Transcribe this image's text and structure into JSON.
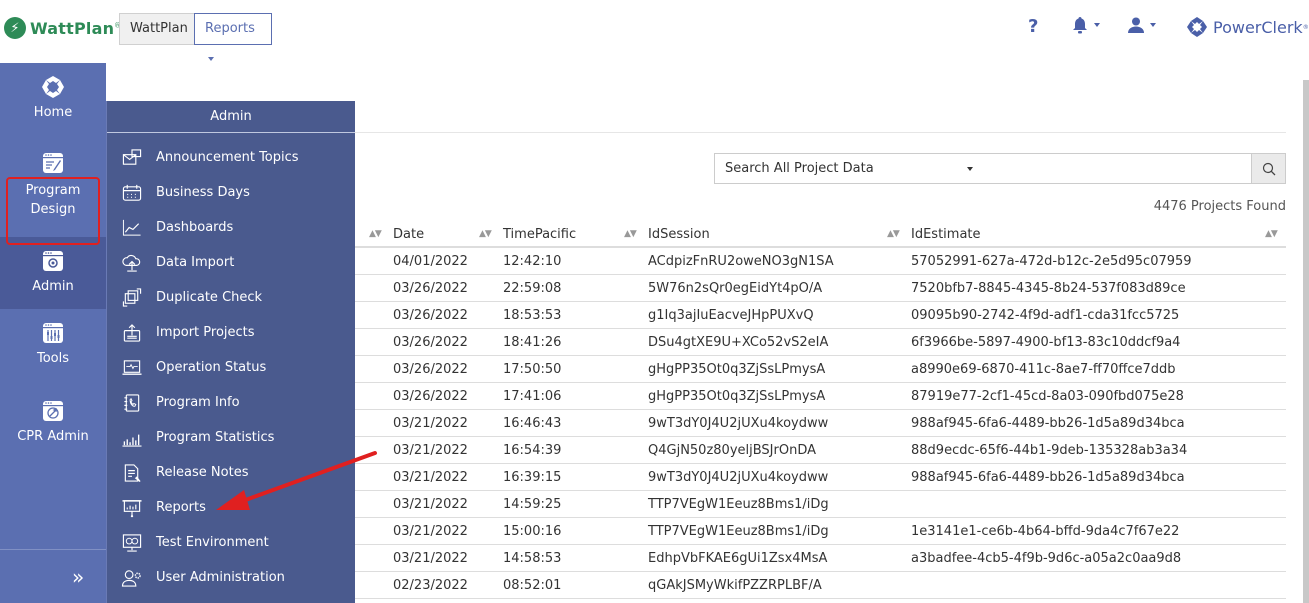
{
  "header": {
    "logo_text": "WattPlan",
    "logo_reg": "®",
    "tabs": [
      {
        "label": "WattPlan",
        "active": false
      },
      {
        "label": "Reports",
        "active": true,
        "has_dropdown": true
      }
    ],
    "icons": [
      "help-icon",
      "bell-icon",
      "user-icon"
    ],
    "help_glyph": "?",
    "brand_text": "PowerClerk",
    "brand_reg": "®"
  },
  "sidebar": {
    "items": [
      {
        "label": "Home",
        "icon": "home-icon"
      },
      {
        "label": "Program Design",
        "icon": "program-design-icon"
      },
      {
        "label": "Admin",
        "icon": "admin-icon",
        "active": true,
        "highlighted": true
      },
      {
        "label": "Tools",
        "icon": "tools-icon"
      },
      {
        "label": "CPR Admin",
        "icon": "cpr-admin-icon"
      }
    ],
    "expand_glyph": "»"
  },
  "admin_menu": {
    "title": "Admin",
    "items": [
      {
        "label": "Announcement Topics",
        "icon": "envelope-icon"
      },
      {
        "label": "Business Days",
        "icon": "calendar-icon"
      },
      {
        "label": "Dashboards",
        "icon": "line-chart-icon"
      },
      {
        "label": "Data Import",
        "icon": "cloud-upload-icon"
      },
      {
        "label": "Duplicate Check",
        "icon": "duplicate-icon"
      },
      {
        "label": "Import Projects",
        "icon": "import-icon"
      },
      {
        "label": "Operation Status",
        "icon": "monitor-pulse-icon"
      },
      {
        "label": "Program Info",
        "icon": "phone-book-icon"
      },
      {
        "label": "Program Statistics",
        "icon": "bar-chart-icon"
      },
      {
        "label": "Release Notes",
        "icon": "document-pen-icon"
      },
      {
        "label": "Reports",
        "icon": "presentation-icon",
        "annotated": true
      },
      {
        "label": "Test Environment",
        "icon": "test-monitor-icon"
      },
      {
        "label": "User Administration",
        "icon": "user-gear-icon"
      }
    ]
  },
  "search": {
    "scope_value": "Search All Project Data",
    "query_value": "",
    "query_placeholder": ""
  },
  "results": {
    "count_text": "4476 Projects Found"
  },
  "table": {
    "columns": [
      "Date",
      "TimePacific",
      "IdSession",
      "IdEstimate"
    ],
    "rows": [
      [
        "04/01/2022",
        "12:42:10",
        "ACdpizFnRU2oweNO3gN1SA",
        "57052991-627a-472d-b12c-2e5d95c07959"
      ],
      [
        "03/26/2022",
        "22:59:08",
        "5W76n2sQr0egEidYt4pO/A",
        "7520bfb7-8845-4345-8b24-537f083d89ce"
      ],
      [
        "03/26/2022",
        "18:53:53",
        "g1Iq3ajIuEacveJHpPUXvQ",
        "09095b90-2742-4f9d-adf1-cda31fcc5725"
      ],
      [
        "03/26/2022",
        "18:41:26",
        "DSu4gtXE9U+XCo52vS2eIA",
        "6f3966be-5897-4900-bf13-83c10ddcf9a4"
      ],
      [
        "03/26/2022",
        "17:50:50",
        "gHgPP35Ot0q3ZjSsLPmysA",
        "a8990e69-6870-411c-8ae7-ff70ffce7ddb"
      ],
      [
        "03/26/2022",
        "17:41:06",
        "gHgPP35Ot0q3ZjSsLPmysA",
        "87919e77-2cf1-45cd-8a03-090fbd075e28"
      ],
      [
        "03/21/2022",
        "16:46:43",
        "9wT3dY0J4U2jUXu4koydww",
        "988af945-6fa6-4489-bb26-1d5a89d34bca"
      ],
      [
        "03/21/2022",
        "16:54:39",
        "Q4GjN50z80yeljBSJrOnDA",
        "88d9ecdc-65f6-44b1-9deb-135328ab3a34"
      ],
      [
        "03/21/2022",
        "16:39:15",
        "9wT3dY0J4U2jUXu4koydww",
        "988af945-6fa6-4489-bb26-1d5a89d34bca"
      ],
      [
        "03/21/2022",
        "14:59:25",
        "TTP7VEgW1Eeuz8Bms1/iDg",
        ""
      ],
      [
        "03/21/2022",
        "15:00:16",
        "TTP7VEgW1Eeuz8Bms1/iDg",
        "1e3141e1-ce6b-4b64-bffd-9da4c7f67e22"
      ],
      [
        "03/21/2022",
        "14:58:53",
        "EdhpVbFKAE6gUi1Zsx4MsA",
        "a3badfee-4cb5-4f9b-9d6c-a05a2c0aa9d8"
      ],
      [
        "02/23/2022",
        "08:52:01",
        "qGAkJSMyWkifPZZRPLBF/A",
        ""
      ]
    ]
  },
  "colors": {
    "sidebar_bg": "#5b6fb1",
    "menu_bg": "#4a5a8e",
    "brand_green": "#2e8b57",
    "brand_blue": "#4a5fa8",
    "annotation_red": "#e02020"
  }
}
